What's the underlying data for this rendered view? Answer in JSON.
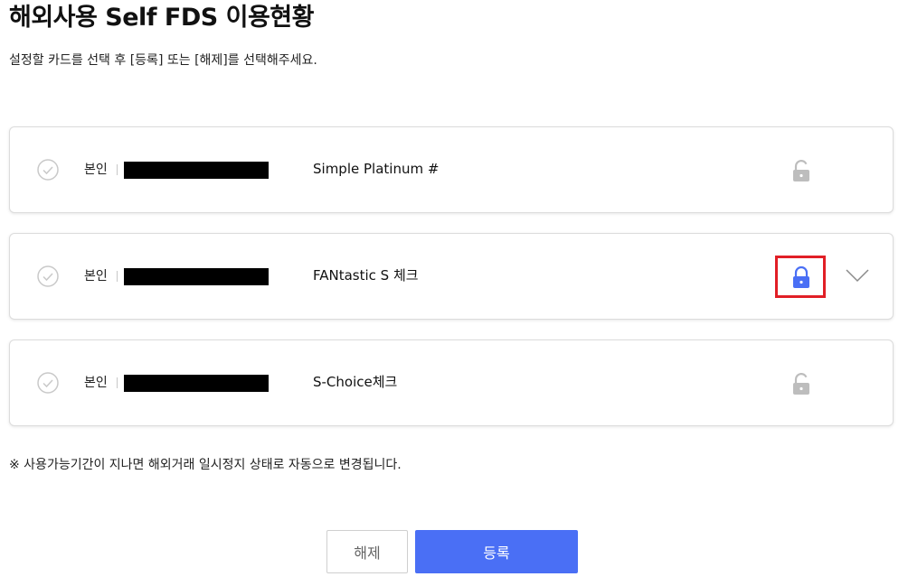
{
  "header": {
    "title": "해외사용 Self FDS 이용현황",
    "subtitle": "설정할 카드를 선택 후 [등록] 또는 [해제]를 선택해주세요."
  },
  "cards": [
    {
      "owner": "본인",
      "name": "Simple Platinum #",
      "lock_state": "unlocked",
      "lock_icon": "unlocked-lock-icon"
    },
    {
      "owner": "본인",
      "name": "FANtastic S 체크",
      "lock_state": "locked",
      "lock_icon": "locked-lock-icon",
      "has_expand": true
    },
    {
      "owner": "본인",
      "name": "S-Choice체크",
      "lock_state": "unlocked",
      "lock_icon": "unlocked-lock-icon"
    }
  ],
  "notice": "※ 사용가능기간이 지나면 해외거래 일시정지 상태로 자동으로 변경됩니다.",
  "buttons": {
    "cancel_label": "해제",
    "register_label": "등록"
  },
  "colors": {
    "accent": "#4a6ff5",
    "lock_active": "#4a6ff5",
    "lock_inactive": "#bdbdbd",
    "highlight_border": "#e11f26",
    "check_inactive": "#c9c9c9"
  }
}
